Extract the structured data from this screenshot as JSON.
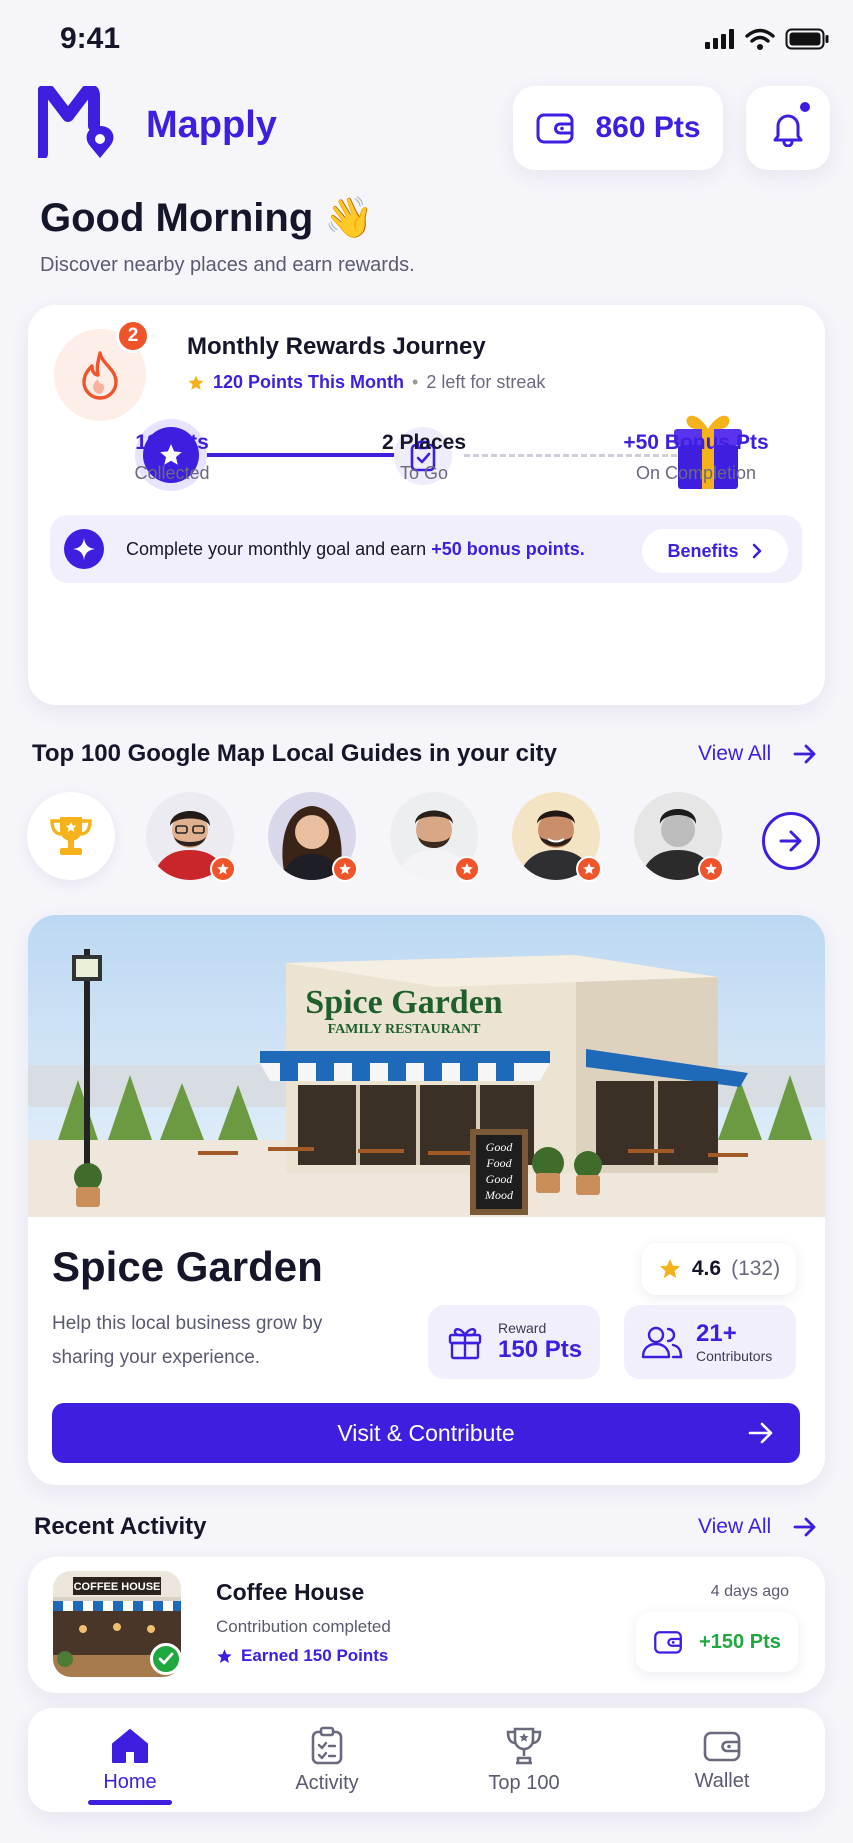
{
  "status_bar": {
    "time": "9:41"
  },
  "header": {
    "app_name": "Mapply",
    "points_label": "860 Pts"
  },
  "greeting": {
    "title": "Good Morning 👋",
    "subtitle": "Discover nearby places and earn rewards."
  },
  "rewards_journey": {
    "streak_badge": "2",
    "title": "Monthly Rewards Journey",
    "points_this_month": "120 Points This Month",
    "streak_text": "2 left for streak",
    "steps": [
      {
        "value": "120 Pts",
        "label": "Collected"
      },
      {
        "value": "2 Places",
        "label": "To Go"
      },
      {
        "value": "+50 Bonus Pts",
        "label": "On Completion"
      }
    ],
    "goal_text": "Complete your monthly goal and earn ",
    "goal_highlight": "+50 bonus points.",
    "benefits_label": "Benefits"
  },
  "guides": {
    "title": "Top 100 Google Map Local Guides in your city",
    "view_all": "View All"
  },
  "featured": {
    "sign_title": "Spice Garden",
    "sign_subtitle": "FAMILY RESTAURANT",
    "board_text": [
      "Good",
      "Food",
      "Good",
      "Mood"
    ],
    "name": "Spice Garden",
    "description": "Help this local business grow by sharing your experience.",
    "rating": "4.6",
    "rating_count": "(132)",
    "reward_label": "Reward",
    "reward_value": "150 Pts",
    "contributors_value": "21+",
    "contributors_label": "Contributors",
    "cta_label": "Visit & Contribute"
  },
  "recent_activity": {
    "title": "Recent Activity",
    "view_all": "View All",
    "items": [
      {
        "thumb_sign": "COFFEE HOUSE",
        "name": "Coffee House",
        "status": "Contribution completed",
        "earned": "Earned 150 Points",
        "time": "4 days ago",
        "points": "+150 Pts"
      }
    ]
  },
  "nav": {
    "items": [
      {
        "label": "Home",
        "icon": "home-icon"
      },
      {
        "label": "Activity",
        "icon": "clipboard-icon"
      },
      {
        "label": "Top 100",
        "icon": "trophy-icon"
      },
      {
        "label": "Wallet",
        "icon": "wallet-icon"
      }
    ],
    "active": "Home"
  },
  "colors": {
    "accent": "#3f1ee0",
    "streak": "#f0542b",
    "success": "#1fa83f",
    "star": "#f5b21a"
  }
}
